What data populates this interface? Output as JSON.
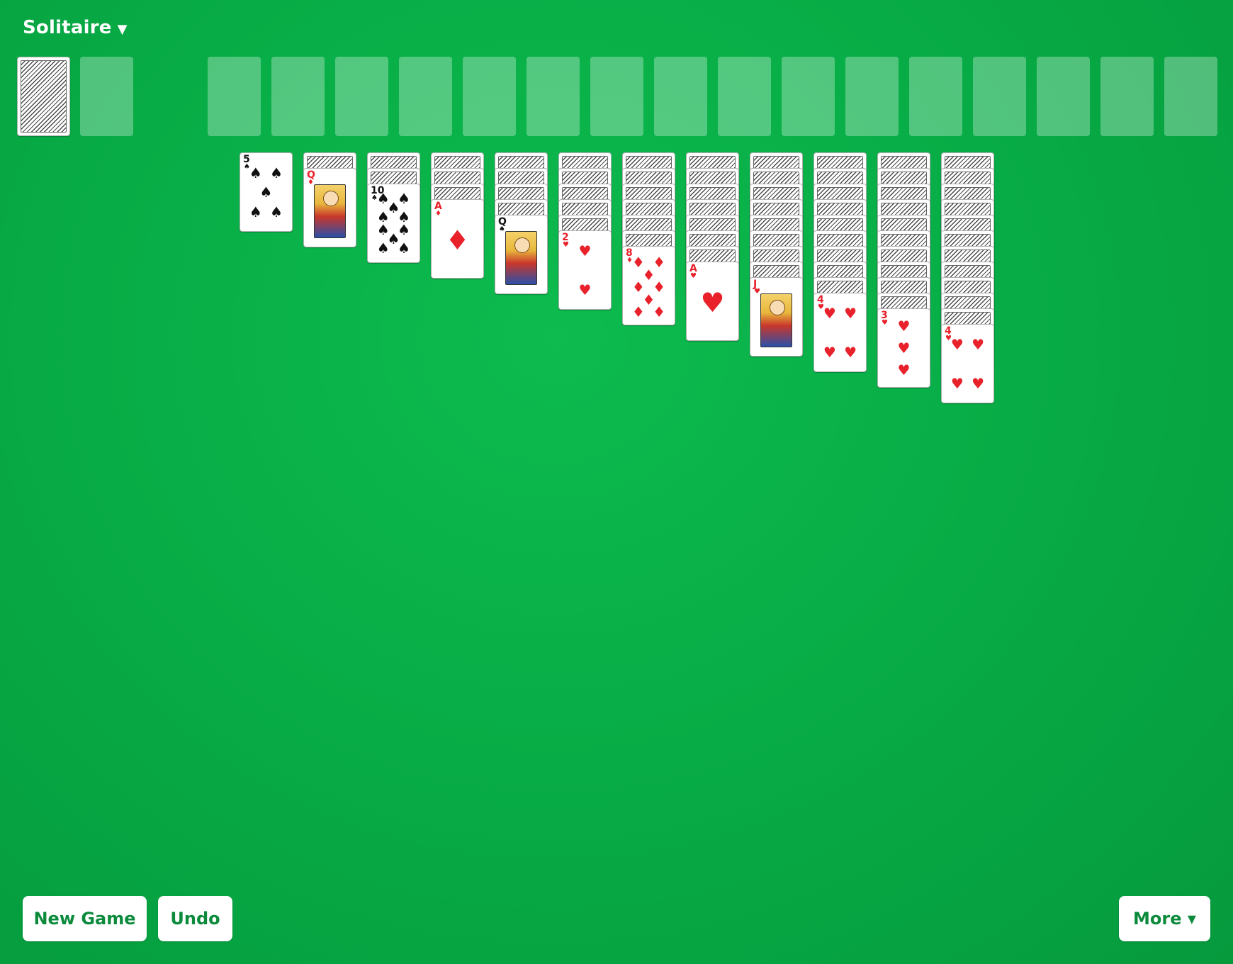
{
  "header": {
    "title": "Solitaire",
    "title_caret": "▼"
  },
  "stock": {
    "count": 1
  },
  "foundations_count": 16,
  "tableau": [
    {
      "hidden": 0,
      "top": {
        "rank": "5",
        "suit": "spades"
      }
    },
    {
      "hidden": 1,
      "top": {
        "rank": "Q",
        "suit": "diamonds"
      }
    },
    {
      "hidden": 2,
      "top": {
        "rank": "10",
        "suit": "spades"
      }
    },
    {
      "hidden": 3,
      "top": {
        "rank": "A",
        "suit": "diamonds"
      }
    },
    {
      "hidden": 4,
      "top": {
        "rank": "Q",
        "suit": "spades"
      }
    },
    {
      "hidden": 5,
      "top": {
        "rank": "2",
        "suit": "hearts"
      }
    },
    {
      "hidden": 6,
      "top": {
        "rank": "8",
        "suit": "diamonds"
      }
    },
    {
      "hidden": 7,
      "top": {
        "rank": "A",
        "suit": "hearts"
      }
    },
    {
      "hidden": 8,
      "top": {
        "rank": "J",
        "suit": "hearts"
      }
    },
    {
      "hidden": 9,
      "top": {
        "rank": "4",
        "suit": "hearts"
      }
    },
    {
      "hidden": 10,
      "top": {
        "rank": "3",
        "suit": "hearts"
      }
    },
    {
      "hidden": 11,
      "top": {
        "rank": "4",
        "suit": "hearts"
      }
    }
  ],
  "toolbar": {
    "new_game_label": "New Game",
    "undo_label": "Undo",
    "more_label": "More ▾"
  },
  "colors": {
    "felt": "#07aa45",
    "red_suit": "#e8212b",
    "black_suit": "#111111",
    "button_text": "#0b8a3c"
  }
}
